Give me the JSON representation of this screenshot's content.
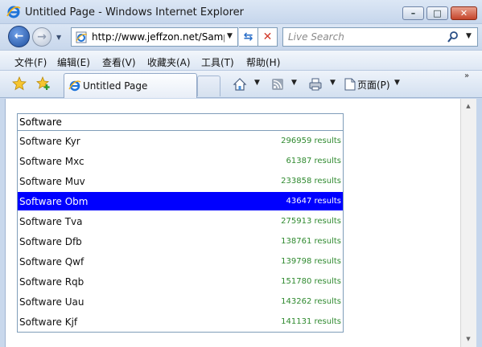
{
  "window": {
    "title": "Untitled Page - Windows Internet Explorer",
    "minimize_glyph": "–",
    "maximize_glyph": "□",
    "close_glyph": "✕"
  },
  "navigation": {
    "address": "http://www.jeffzon.net/Samp",
    "search_placeholder": "Live Search"
  },
  "menu": {
    "items": [
      "文件(F)",
      "编辑(E)",
      "查看(V)",
      "收藏夹(A)",
      "工具(T)",
      "帮助(H)"
    ]
  },
  "toolbar": {
    "tab_title": "Untitled Page",
    "page_label": "页面(P)",
    "overflow": "»"
  },
  "autocomplete": {
    "query": "Software",
    "selected_index": 3,
    "items": [
      {
        "name": "Software Kyr",
        "count": "296959 results"
      },
      {
        "name": "Software Mxc",
        "count": "61387 results"
      },
      {
        "name": "Software Muv",
        "count": "233858 results"
      },
      {
        "name": "Software Obm",
        "count": "43647 results"
      },
      {
        "name": "Software Tva",
        "count": "275913 results"
      },
      {
        "name": "Software Dfb",
        "count": "138761 results"
      },
      {
        "name": "Software Qwf",
        "count": "139798 results"
      },
      {
        "name": "Software Rqb",
        "count": "151780 results"
      },
      {
        "name": "Software Uau",
        "count": "143262 results"
      },
      {
        "name": "Software Kjf",
        "count": "141131 results"
      }
    ]
  },
  "colors": {
    "selection": "#0000ff",
    "result_count": "#2f8a2f"
  }
}
